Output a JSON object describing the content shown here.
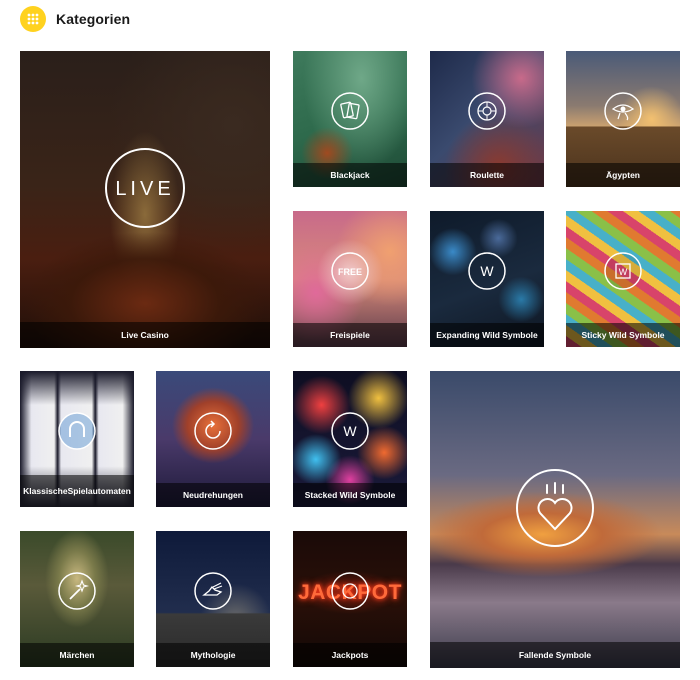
{
  "header": {
    "title": "Kategorien",
    "menu_icon": "grid-icon",
    "accent": "#ffd21f"
  },
  "tiles": [
    {
      "id": "live-casino",
      "label": "Live Casino",
      "icon": "live-icon",
      "icon_text": "LIVE"
    },
    {
      "id": "blackjack",
      "label": "Blackjack",
      "icon": "cards-icon"
    },
    {
      "id": "roulette",
      "label": "Roulette",
      "icon": "roulette-wheel-icon"
    },
    {
      "id": "aegypten",
      "label": "Ägypten",
      "icon": "eye-of-horus-icon"
    },
    {
      "id": "freispiele",
      "label": "Freispiele",
      "icon": "free-icon",
      "icon_text": "FREE"
    },
    {
      "id": "expanding-wild",
      "label": "Expanding Wild Symbole",
      "icon": "wild-w-icon",
      "icon_text": "W"
    },
    {
      "id": "sticky-wild",
      "label": "Sticky Wild Symbole",
      "icon": "sticky-wild-icon",
      "icon_text": "W"
    },
    {
      "id": "klassische",
      "label_line1": "Klassische",
      "label_line2": "Spielautomaten",
      "icon": "horseshoe-icon"
    },
    {
      "id": "neudrehungen",
      "label": "Neudrehungen",
      "icon": "respin-icon"
    },
    {
      "id": "stacked-wild",
      "label": "Stacked Wild Symbole",
      "icon": "stacked-wild-icon",
      "icon_text": "W"
    },
    {
      "id": "fallende",
      "label": "Fallende Symbole",
      "icon": "falling-heart-icon"
    },
    {
      "id": "maerchen",
      "label": "Märchen",
      "icon": "magic-wand-icon"
    },
    {
      "id": "mythologie",
      "label": "Mythologie",
      "icon": "winged-shoe-icon"
    },
    {
      "id": "jackpots",
      "label": "Jackpots",
      "icon": "jackpot-coin-icon",
      "sign_text": "JACKPOT"
    }
  ]
}
